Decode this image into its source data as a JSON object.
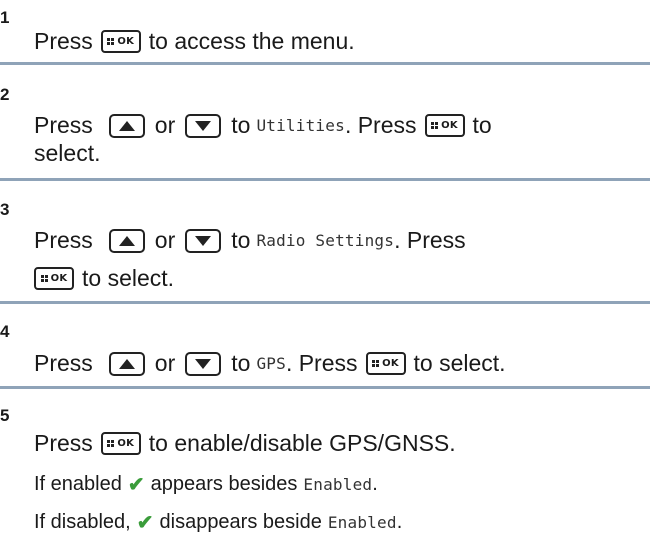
{
  "steps": [
    {
      "num": "1",
      "line1": {
        "a": "Press",
        "b": "to access the menu."
      }
    },
    {
      "num": "2",
      "line1": {
        "a": "Press",
        "or": "or",
        "to": "to",
        "target": "Utilities",
        "press": ". Press",
        "end": "to"
      },
      "line2": {
        "a": "select."
      }
    },
    {
      "num": "3",
      "line1": {
        "a": "Press",
        "or": "or",
        "to": "to",
        "target": "Radio Settings",
        "press": ". Press"
      },
      "line2": {
        "b": "to select."
      }
    },
    {
      "num": "4",
      "line1": {
        "a": "Press",
        "or": "or",
        "to": "to",
        "target": "GPS",
        "press": ". Press",
        "end": "to select."
      }
    },
    {
      "num": "5",
      "line1": {
        "a": "Press",
        "b": "to enable/disable GPS/GNSS."
      },
      "line2": {
        "a": "If enabled",
        "b": "appears besides",
        "target": "Enabled",
        "end": "."
      },
      "line3": {
        "a": "If disabled,",
        "b": "disappears beside",
        "target": "Enabled",
        "end": "."
      }
    }
  ],
  "icons": {
    "ok_key_label": "OK",
    "up": "up-arrow-key-icon",
    "down": "down-arrow-key-icon",
    "check": "✔",
    "check_color": "#3a9c3a"
  },
  "colors": {
    "separator": "#8fa3b8"
  }
}
